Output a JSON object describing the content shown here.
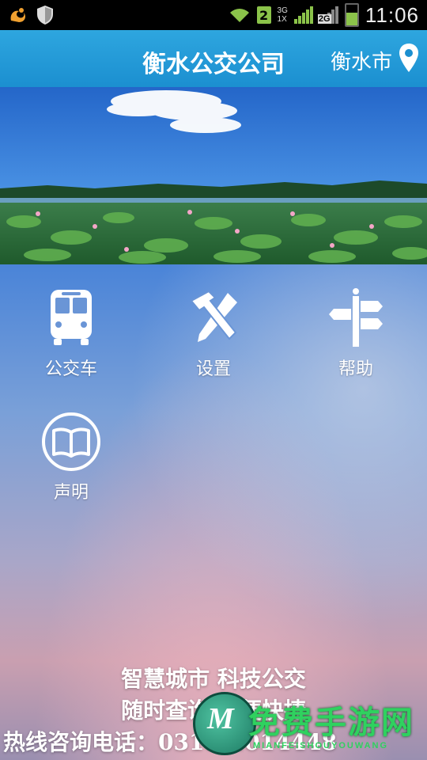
{
  "statusbar": {
    "time": "11:06",
    "sim_slot": "2",
    "net_type_top": "3G",
    "net_type_bottom": "1X",
    "net_type_2": "2G",
    "icons": [
      "uc-browser-icon",
      "shield-icon",
      "wifi-icon",
      "sim-icon",
      "signal-icon",
      "signal-2g-icon",
      "battery-icon"
    ]
  },
  "appbar": {
    "title": "衡水公交公司",
    "city": "衡水市",
    "location_icon": "location-pin-icon",
    "color": "#1f9ad6"
  },
  "menu": [
    {
      "label": "公交车",
      "icon": "bus-icon"
    },
    {
      "label": "设置",
      "icon": "tools-icon"
    },
    {
      "label": "帮助",
      "icon": "signpost-icon"
    },
    {
      "label": "声明",
      "icon": "book-icon"
    }
  ],
  "slogan": {
    "line1": "智慧城市  科技公交",
    "line2": "随时查询  方便快捷"
  },
  "hotline": "热线咨询电话：0318-2014448",
  "watermark": {
    "text": "免费手游网",
    "sub": "MIANFEISHOUYOUWANG",
    "logo_letter": "M"
  }
}
